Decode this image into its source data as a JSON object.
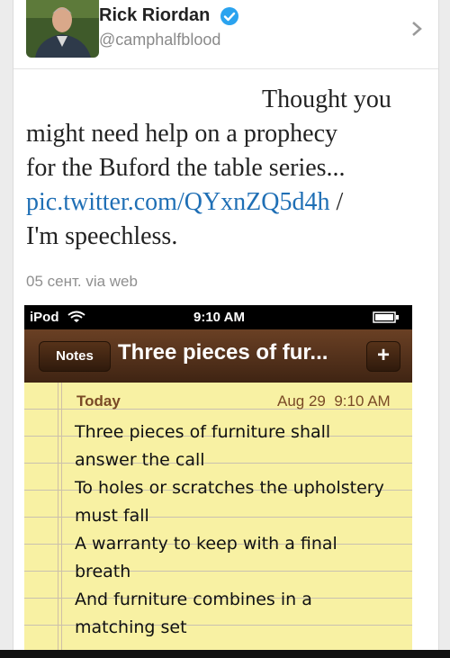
{
  "profile": {
    "name": "Rick Riordan",
    "handle": "@camphalfblood"
  },
  "tweet": {
    "lines": [
      "Thought you",
      "might need help on a prophecy",
      "for the Buford the table series..."
    ],
    "link": "pic.twitter.com/QYxnZQ5d4h",
    "link_suffix": " /",
    "last_line": "I'm speechless.",
    "meta": "05 сент. via web"
  },
  "screenshot": {
    "status": {
      "carrier": "iPod",
      "time": "9:10 AM"
    },
    "nav": {
      "back_label": "Notes",
      "title": "Three pieces of fur...",
      "add_label": "+"
    },
    "note": {
      "heading": "Today",
      "date": "Aug 29",
      "time": "9:10 AM",
      "lines": [
        "Three pieces of furniture shall",
        "answer the call",
        "To holes or scratches the upholstery",
        "must fall",
        "A warranty to keep with a final",
        "breath",
        "And furniture combines in a",
        "matching set"
      ]
    }
  },
  "colors": {
    "link": "#1f6fb5",
    "verified": "#2aa3ef",
    "note_paper": "#f8f1a3",
    "nav_brown": "#5a351d"
  },
  "icons": [
    "avatar",
    "verified-badge-icon",
    "chevron-right-icon",
    "wifi-icon",
    "battery-icon"
  ]
}
